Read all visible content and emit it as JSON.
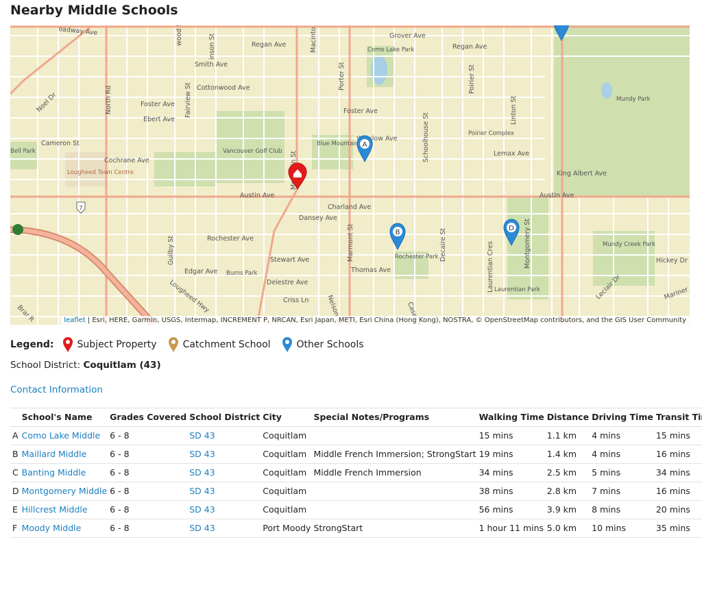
{
  "page_title": "Nearby Middle Schools",
  "map": {
    "attribution_link": "leaflet",
    "attribution_text": " | Esri, HERE, Garmin, USGS, Intermap, INCREMENT P, NRCAN, Esri Japan, METI, Esri China (Hong Kong), NOSTRA, © OpenStreetMap contributors, and the GIS User Community",
    "labels": {
      "broadway": "oadway Ave",
      "grover": "Grover Ave",
      "regan1": "Regan Ave",
      "regan2": "Regan Ave",
      "smith": "Smith Ave",
      "cottonwood": "Cottonwood Ave",
      "foster1": "Foster Ave",
      "foster2": "Foster Ave",
      "ebert": "Ebert Ave",
      "cameron": "Cameron St",
      "cochrane": "Cochrane Ave",
      "winslow": "Winslow Ave",
      "lemax": "Lemax Ave",
      "kingalbert": "King Albert Ave",
      "austin1": "Austin Ave",
      "austin2": "Austin Ave",
      "charland": "Charland Ave",
      "dansey": "Dansey Ave",
      "rochester": "Rochester Ave",
      "stewart": "Stewart Ave",
      "edgar": "Edgar Ave",
      "thomas": "Thomas Ave",
      "delestre": "Delestre Ave",
      "criss": "Criss Ln",
      "como": "Como Lake Park",
      "mundy": "Mundy Park",
      "vancouver": "Vancouver Golf Club",
      "bluemountain": "Blue Mountain Park",
      "lougheed": "Lougheed Town Centre",
      "poirier": "Poirier Complex",
      "rochesterpark": "Rochester Park",
      "laurentian": "Laurentian Park",
      "mundycreek": "Mundy Creek Park",
      "burns": "Burns Park",
      "bell": "Bell Park",
      "hickey": "Hickey Dr",
      "lougheedhwy": "Lougheed Hwy",
      "northrd": "North Rd",
      "mountain": "Mountain St",
      "porter": "Porter St",
      "schoolhouse": "Schoolhouse St",
      "linton": "Linton St",
      "poirierst": "Poirier St",
      "marmont": "Marmont St",
      "nelson": "Nelson St",
      "decaire": "Decaire St",
      "casey": "Casey St",
      "montgomery": "Montgomery St",
      "guilby": "Guilby St",
      "fairview": "Fairview St",
      "laurentiancres": "Laurentian Cres",
      "noel": "Noel Dr",
      "leclair": "Leclair Dr",
      "mariner": "Mariner",
      "hwy7": "7",
      "macinto": "Macinto",
      "linson": "inson St",
      "wood": "wood St",
      "brar": "Brar R"
    },
    "markers": {
      "a": "A",
      "b": "B",
      "d": "D"
    }
  },
  "legend": {
    "label": "Legend:",
    "items": [
      {
        "label": "Subject Property",
        "color": "#e21b1b"
      },
      {
        "label": "Catchment School",
        "color": "#c89a4e"
      },
      {
        "label": "Other Schools",
        "color": "#2b8ad6"
      }
    ]
  },
  "district": {
    "label": "School District: ",
    "value": "Coquitlam (43)"
  },
  "contact_link": "Contact Information",
  "table": {
    "headers": [
      "",
      "School's Name",
      "Grades Covered",
      "School District",
      "City",
      "Special Notes/Programs",
      "Walking Time",
      "Distance",
      "Driving Time",
      "Transit Time"
    ],
    "rows": [
      {
        "letter": "A",
        "name": "Como Lake Middle",
        "grades": "6 - 8",
        "district": "SD 43",
        "city": "Coquitlam",
        "notes": "",
        "walk": "15 mins",
        "distance": "1.1 km",
        "drive": "4 mins",
        "transit": "15 mins"
      },
      {
        "letter": "B",
        "name": "Maillard Middle",
        "grades": "6 - 8",
        "district": "SD 43",
        "city": "Coquitlam",
        "notes": "Middle French Immersion; StrongStart",
        "walk": "19 mins",
        "distance": "1.4 km",
        "drive": "4 mins",
        "transit": "16 mins"
      },
      {
        "letter": "C",
        "name": "Banting Middle",
        "grades": "6 - 8",
        "district": "SD 43",
        "city": "Coquitlam",
        "notes": "Middle French Immersion",
        "walk": "34 mins",
        "distance": "2.5 km",
        "drive": "5 mins",
        "transit": "34 mins"
      },
      {
        "letter": "D",
        "name": "Montgomery Middle",
        "grades": "6 - 8",
        "district": "SD 43",
        "city": "Coquitlam",
        "notes": "",
        "walk": "38 mins",
        "distance": "2.8 km",
        "drive": "7 mins",
        "transit": "16 mins"
      },
      {
        "letter": "E",
        "name": "Hillcrest Middle",
        "grades": "6 - 8",
        "district": "SD 43",
        "city": "Coquitlam",
        "notes": "",
        "walk": "56 mins",
        "distance": "3.9 km",
        "drive": "8 mins",
        "transit": "20 mins"
      },
      {
        "letter": "F",
        "name": "Moody Middle",
        "grades": "6 - 8",
        "district": "SD 43",
        "city": "Port Moody",
        "notes": "StrongStart",
        "walk": "1 hour 11 mins",
        "distance": "5.0 km",
        "drive": "10 mins",
        "transit": "35 mins"
      }
    ]
  }
}
